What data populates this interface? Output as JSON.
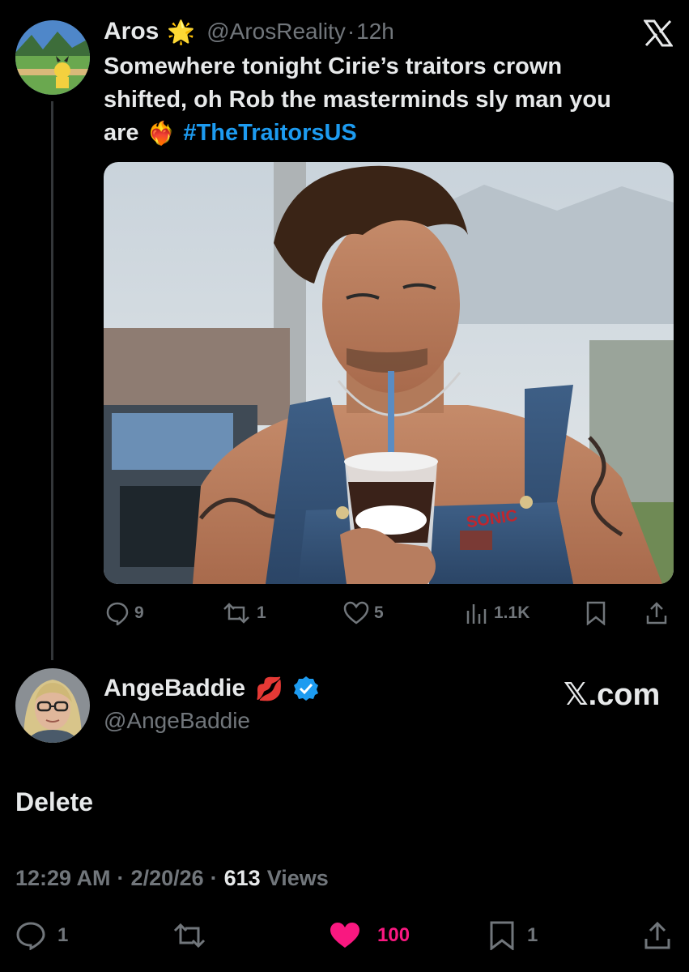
{
  "parent_tweet": {
    "display_name": "Aros",
    "name_emoji": "🌟",
    "handle": "@ArosReality",
    "separator": "·",
    "time": "12h",
    "text_line1": "Somewhere tonight Cirie’s traitors crown",
    "text_line2": "shifted, oh Rob the masterminds sly man you",
    "text_line3_prefix": "are",
    "text_emoji": "❤️‍🔥",
    "hashtag": "#TheTraitorsUS",
    "media_cup_label": "SONIC",
    "actions": {
      "replies": "9",
      "reposts": "1",
      "likes": "5",
      "views": "1.1K"
    }
  },
  "reply_tweet": {
    "display_name": "AngeBaddie",
    "name_emoji": "💋",
    "handle": "@AngeBaddie",
    "brand": "𝕏.com",
    "text": "Delete",
    "meta": {
      "time": "12:29 AM",
      "date": "2/20/26",
      "separator": "·",
      "views_count": "613",
      "views_label": "Views"
    },
    "actions": {
      "replies": "1",
      "likes": "100",
      "bookmarks": "1"
    }
  },
  "colors": {
    "background": "#000000",
    "primary_text": "#e7e9ea",
    "secondary_text": "#71767b",
    "link": "#1d9bf0",
    "verified": "#1d9bf0",
    "like_active": "#f91880"
  }
}
